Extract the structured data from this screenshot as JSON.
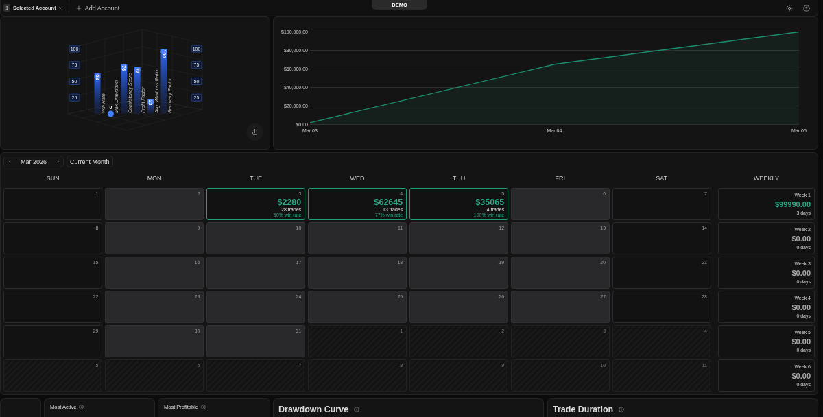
{
  "top_bar": {
    "account_badge": "1",
    "account_label": "Selected Account",
    "add_account": "Add Account",
    "mode_tab": "DEMO"
  },
  "metrics_chart": {
    "left_scale": [
      "100",
      "75",
      "50",
      "25"
    ],
    "chart_data": {
      "type": "bar",
      "categories": [
        "Win Rate",
        "Max Drawdown",
        "Consistency Score",
        "Profit Factor",
        "Avg. Win/Loss Ratio",
        "Recovery Factor"
      ],
      "values": [
        62,
        0,
        76,
        72,
        23,
        100
      ],
      "ylim": [
        0,
        100
      ],
      "yticks": [
        25,
        50,
        75,
        100
      ],
      "data_labels": true
    }
  },
  "equity_chart": {
    "chart_data": {
      "type": "area",
      "x": [
        "Mar 03",
        "Mar 04",
        "Mar 05"
      ],
      "series": [
        {
          "color": "#1d8f6f",
          "values": [
            2000,
            65000,
            100000
          ]
        }
      ],
      "ylim": [
        0,
        100000
      ],
      "yticks": [
        {
          "value": 0,
          "label": "$0.00"
        },
        {
          "value": 20000,
          "label": "$20,000.00"
        },
        {
          "value": 40000,
          "label": "$40,000.00"
        },
        {
          "value": 60000,
          "label": "$60,000.00"
        },
        {
          "value": 80000,
          "label": "$80,000.00"
        },
        {
          "value": 100000,
          "label": "$100,000.00"
        }
      ],
      "grid": true
    }
  },
  "calendar": {
    "month": "Mar 2026",
    "current_month_button": "Current Month",
    "weekdays": [
      "SUN",
      "MON",
      "TUE",
      "WED",
      "THU",
      "FRI",
      "SAT"
    ],
    "weekly_header": "WEEKLY",
    "weeks": [
      {
        "days": [
          {
            "number": "1",
            "kind": "weekend"
          },
          {
            "number": "2",
            "kind": "weekday"
          },
          {
            "number": "3",
            "kind": "trade",
            "pnl": "$2280",
            "trades": "28 trades",
            "win_rate": "50% win rate"
          },
          {
            "number": "4",
            "kind": "trade",
            "pnl": "$62645",
            "trades": "13 trades",
            "win_rate": "77% win rate"
          },
          {
            "number": "5",
            "kind": "trade",
            "pnl": "$35065",
            "trades": "4 trades",
            "win_rate": "100% win rate"
          },
          {
            "number": "6",
            "kind": "weekday"
          },
          {
            "number": "7",
            "kind": "weekend"
          }
        ],
        "summary": {
          "label": "Week 1",
          "amount": "$99990.00",
          "days": "3 days",
          "kind": "profit"
        }
      },
      {
        "days": [
          {
            "number": "8",
            "kind": "weekend"
          },
          {
            "number": "9",
            "kind": "weekday"
          },
          {
            "number": "10",
            "kind": "weekday"
          },
          {
            "number": "11",
            "kind": "weekday"
          },
          {
            "number": "12",
            "kind": "weekday"
          },
          {
            "number": "13",
            "kind": "weekday"
          },
          {
            "number": "14",
            "kind": "weekend"
          }
        ],
        "summary": {
          "label": "Week 2",
          "amount": "$0.00",
          "days": "0 days",
          "kind": "flat"
        }
      },
      {
        "days": [
          {
            "number": "15",
            "kind": "weekend"
          },
          {
            "number": "16",
            "kind": "weekday"
          },
          {
            "number": "17",
            "kind": "weekday"
          },
          {
            "number": "18",
            "kind": "weekday"
          },
          {
            "number": "19",
            "kind": "weekday"
          },
          {
            "number": "20",
            "kind": "weekday"
          },
          {
            "number": "21",
            "kind": "weekend"
          }
        ],
        "summary": {
          "label": "Week 3",
          "amount": "$0.00",
          "days": "0 days",
          "kind": "flat"
        }
      },
      {
        "days": [
          {
            "number": "22",
            "kind": "weekend"
          },
          {
            "number": "23",
            "kind": "weekday"
          },
          {
            "number": "24",
            "kind": "weekday"
          },
          {
            "number": "25",
            "kind": "weekday"
          },
          {
            "number": "26",
            "kind": "weekday"
          },
          {
            "number": "27",
            "kind": "weekday"
          },
          {
            "number": "28",
            "kind": "weekend"
          }
        ],
        "summary": {
          "label": "Week 4",
          "amount": "$0.00",
          "days": "0 days",
          "kind": "flat"
        }
      },
      {
        "days": [
          {
            "number": "29",
            "kind": "weekend"
          },
          {
            "number": "30",
            "kind": "weekday"
          },
          {
            "number": "31",
            "kind": "weekday"
          },
          {
            "number": "1",
            "kind": "outside"
          },
          {
            "number": "2",
            "kind": "outside"
          },
          {
            "number": "3",
            "kind": "outside"
          },
          {
            "number": "4",
            "kind": "outside"
          }
        ],
        "summary": {
          "label": "Week 5",
          "amount": "$0.00",
          "days": "0 days",
          "kind": "flat"
        }
      },
      {
        "days": [
          {
            "number": "5",
            "kind": "outside"
          },
          {
            "number": "6",
            "kind": "outside"
          },
          {
            "number": "7",
            "kind": "outside"
          },
          {
            "number": "8",
            "kind": "outside"
          },
          {
            "number": "9",
            "kind": "outside"
          },
          {
            "number": "10",
            "kind": "outside"
          },
          {
            "number": "11",
            "kind": "outside"
          }
        ],
        "summary": {
          "label": "Week 6",
          "amount": "$0.00",
          "days": "0 days",
          "kind": "flat"
        }
      }
    ]
  },
  "stat_cards": [
    {
      "title": "Most Active"
    },
    {
      "title": "Most Profitable"
    }
  ],
  "panels": [
    {
      "title": "Drawdown Curve"
    },
    {
      "title": "Trade Duration"
    }
  ]
}
